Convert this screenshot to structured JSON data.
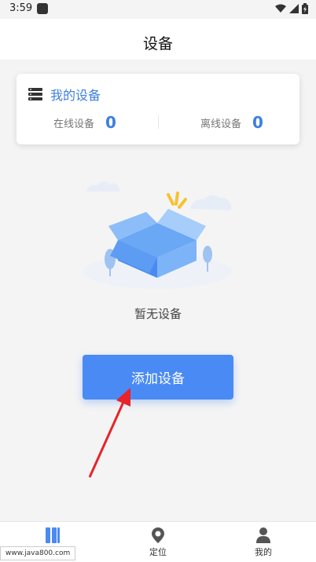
{
  "status_bar": {
    "time": "3:59"
  },
  "header": {
    "title": "设备"
  },
  "device_card": {
    "title": "我的设备",
    "online_label": "在线设备",
    "online_count": "0",
    "offline_label": "离线设备",
    "offline_count": "0"
  },
  "empty_state": {
    "text": "暂无设备"
  },
  "add_button": {
    "label": "添加设备"
  },
  "bottom_nav": {
    "items": [
      {
        "label": "设备",
        "icon": "device-icon",
        "active": true
      },
      {
        "label": "定位",
        "icon": "location-pin-icon",
        "active": false
      },
      {
        "label": "我的",
        "icon": "person-icon",
        "active": false
      }
    ]
  },
  "watermark": {
    "text": "www.java800.com"
  },
  "colors": {
    "accent": "#4a8af4",
    "card_title": "#3d7fde"
  }
}
